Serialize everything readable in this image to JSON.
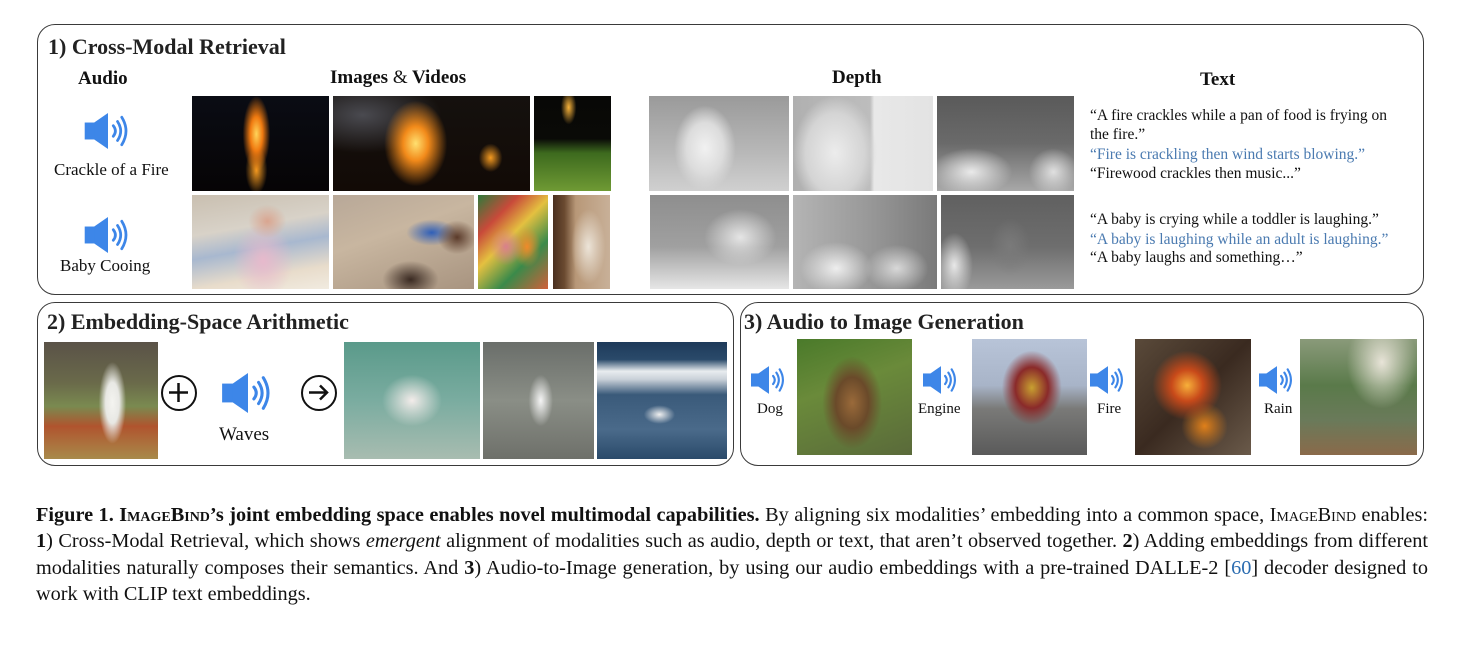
{
  "panels": {
    "retrieval": {
      "title": "1) Cross-Modal Retrieval",
      "headers": {
        "audio": "Audio",
        "images_a": "Images",
        "images_amp": "&",
        "images_b": "Videos",
        "depth": "Depth",
        "text": "Text"
      },
      "rows": [
        {
          "audio_label": "Crackle of a Fire",
          "images": [
            "fire scene reflected in water",
            "bonfire at night with person",
            "burning torch on grass at night"
          ],
          "depth": [
            "depth map of fireplace",
            "depth map of fireplace with TV",
            "depth map of living room"
          ],
          "texts": [
            {
              "text": "“A fire crackles while a pan of food is frying on",
              "style": "black"
            },
            {
              "text": "the fire.”",
              "style": "black"
            },
            {
              "text": "“Fire is crackling then wind starts blowing.”",
              "style": "blue"
            },
            {
              "text": "“Firewood crackles then music...”",
              "style": "black"
            }
          ]
        },
        {
          "audio_label": "Baby Cooing",
          "images": [
            "baby sitting on couch",
            "children playing with toys",
            "babies lying in crib",
            "baby standing in doorway"
          ],
          "depth": [
            "depth map of nursery with crib",
            "depth map of armchair and crib",
            "depth map of room with crib"
          ],
          "texts": [
            {
              "text": "“A baby is crying while a toddler is laughing.”",
              "style": "black"
            },
            {
              "text": "“A baby is laughing while an adult is laughing.”",
              "style": "blue"
            },
            {
              "text": "“A baby laughs and something…”",
              "style": "black"
            }
          ]
        }
      ]
    },
    "arithmetic": {
      "title": "2) Embedding-Space Arithmetic",
      "input_image": "egret standing in grass",
      "plus_symbol": "+",
      "audio_label": "Waves",
      "arrow_symbol": "→",
      "results": [
        "egret wading in water",
        "egret walking on wet shore",
        "egret feeding in ocean waves"
      ]
    },
    "generation": {
      "title": "3) Audio to Image Generation",
      "items": [
        {
          "audio_label": "Dog",
          "image": "generated image of German shepherd dog"
        },
        {
          "audio_label": "Engine",
          "image": "generated image of truck on road"
        },
        {
          "audio_label": "Fire",
          "image": "generated image of burning firewood"
        },
        {
          "audio_label": "Rain",
          "image": "generated image of rain in forest"
        }
      ]
    }
  },
  "caption": {
    "fig_label": "Figure 1.",
    "name_cap1": "I",
    "name_rest1": "mage",
    "name_cap2": "B",
    "name_rest2": "ind",
    "bold_tail": "’s joint embedding space enables novel multimodal capabilities.",
    "s1": " By aligning six modalities’ embedding into a common space, ",
    "s2": " enables: ",
    "n1": "1",
    "s3": ") Cross-Modal Retrieval, which shows ",
    "em": "emergent",
    "s4": " alignment of modalities such as audio, depth or text, that aren’t observed together. ",
    "n2": "2",
    "s5": ") Adding embeddings from different modalities naturally composes their semantics. And ",
    "n3": "3",
    "s6": ") Audio-to-Image generation, by using our audio embeddings with a pre-trained DALLE-2 [",
    "citation": "60",
    "s7": "] decoder designed to work with CLIP text embeddings."
  },
  "colors": {
    "speaker": "#3d86e8",
    "blue_text": "#4a7ab0",
    "citation": "#2b6cb0",
    "border": "#3a3a3a"
  }
}
